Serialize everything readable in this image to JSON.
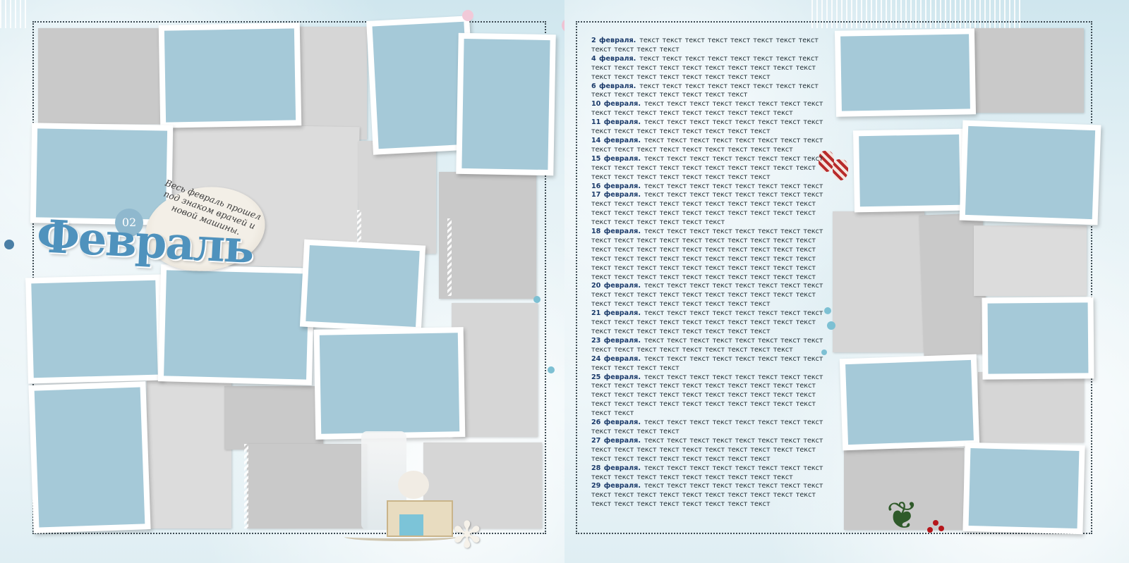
{
  "album": {
    "month_title": "Февраль",
    "day_number": "02",
    "caption": "Весь февраль прошел под знаком врачей и новой машины."
  },
  "diary": [
    {
      "date": "2 февраля.",
      "text": "текст текст текст текст текст текст текст текст текст текст текст текст"
    },
    {
      "date": "4 февраля.",
      "text": "текст текст текст текст текст текст текст текст текст текст текст текст текст текст текст текст текст текст текст текст текст текст текст текст текст текст"
    },
    {
      "date": "6 февраля.",
      "text": "текст текст текст текст текст текст текст текст текст текст текст текст текст текст текст"
    },
    {
      "date": "10 февраля.",
      "text": "текст текст текст текст текст текст текст текст текст текст текст текст текст текст текст текст текст"
    },
    {
      "date": "11 февраля.",
      "text": "текст текст текст текст текст текст текст текст текст текст текст текст текст текст текст текст"
    },
    {
      "date": "14 февраля.",
      "text": "текст текст текст текст текст текст текст текст текст текст текст текст текст текст текст текст текст"
    },
    {
      "date": "15 февраля.",
      "text": "текст текст текст текст текст текст текст текст текст текст текст текст текст текст текст текст текст текст текст текст текст текст текст текст текст текст"
    },
    {
      "date": "16 февраля.",
      "text": "текст текст текст текст текст текст текст текст"
    },
    {
      "date": "17 февраля.",
      "text": "текст текст текст текст текст текст текст текст текст текст текст текст текст текст текст текст текст текст текст текст текст текст текст текст текст текст текст текст текст текст текст текст текст текст"
    },
    {
      "date": "18 февраля.",
      "text": "текст текст текст текст текст текст текст текст текст текст текст текст текст текст текст текст текст текст текст текст текст текст текст текст текст текст текст текст текст текст текст текст текст текст текст текст текст текст текст текст текст текст текст текст текст текст текст текст текст текст текст текст текст текст текст текст текст текст"
    },
    {
      "date": "20 февраля.",
      "text": "текст текст текст текст текст текст текст текст текст текст текст текст текст текст текст текст текст текст текст текст текст текст текст текст текст текст"
    },
    {
      "date": "21 февраля.",
      "text": "текст текст текст текст текст текст текст текст текст текст текст текст текст текст текст текст текст текст текст текст текст текст текст текст текст текст"
    },
    {
      "date": "23 февраля.",
      "text": "текст текст текст текст текст текст текст текст текст текст текст текст текст текст текст текст текст"
    },
    {
      "date": "24 февраля.",
      "text": "текст текст текст текст текст текст текст текст текст текст текст текст"
    },
    {
      "date": "25 февраля.",
      "text": "текст текст текст текст текст текст текст текст текст текст текст текст текст текст текст текст текст текст текст текст текст текст текст текст текст текст текст текст текст текст текст текст текст текст текст текст текст текст текст текст"
    },
    {
      "date": "26 февраля.",
      "text": "текст текст текст текст текст текст текст текст текст текст текст текст"
    },
    {
      "date": "27 февраля.",
      "text": "текст текст текст текст текст текст текст текст текст текст текст текст текст текст текст текст текст текст текст текст текст текст текст текст текст текст"
    },
    {
      "date": "28 февраля.",
      "text": "текст текст текст текст текст текст текст текст текст текст текст текст текст текст текст текст текст"
    },
    {
      "date": "29 февраля.",
      "text": "текст текст текст текст текст текст текст текст текст текст текст текст текст текст текст текст текст текст текст текст текст текст текст текст текст текст"
    }
  ],
  "colors": {
    "photo_slot": "#a5c9d8",
    "paper": "#c9c9c9",
    "title": "#4f92bd",
    "stitch": "#3c4a52"
  }
}
